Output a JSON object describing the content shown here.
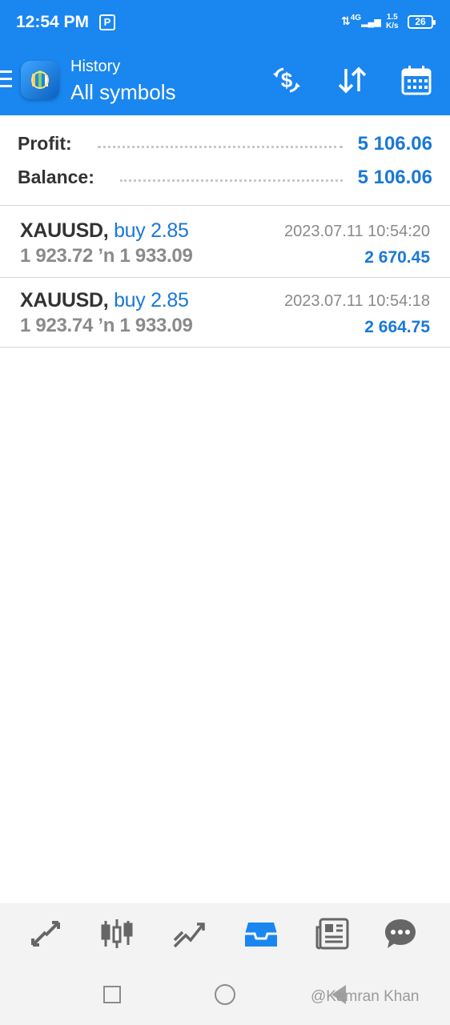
{
  "status": {
    "time": "12:54 PM",
    "notification_badge": "P",
    "network": "4G",
    "speed_top": "1.5",
    "speed_bottom": "K/s",
    "battery": "26"
  },
  "header": {
    "title_small": "History",
    "title_big": "All symbols",
    "icons": [
      "menu-icon",
      "app-logo-icon",
      "deposit-withdraw-icon",
      "sort-icon",
      "calendar-icon"
    ]
  },
  "summary": {
    "profit_label": "Profit:",
    "profit_value": "5 106.06",
    "balance_label": "Balance:",
    "balance_value": "5 106.06"
  },
  "trades": [
    {
      "symbol": "XAUUSD,",
      "side": "buy 2.85",
      "prices": "1 923.72 ’n  1 933.09",
      "time": "2023.07.11 10:54:20",
      "profit": "2 670.45"
    },
    {
      "symbol": "XAUUSD,",
      "side": "buy 2.85",
      "prices": "1 923.74 ’n  1 933.09",
      "time": "2023.07.11 10:54:18",
      "profit": "2 664.75"
    }
  ],
  "bottom_tabs": [
    "quotes-icon",
    "chart-icon",
    "trade-icon",
    "history-icon",
    "news-icon",
    "chat-icon"
  ],
  "active_tab": "history-icon",
  "watermark": "@Kamran Khan",
  "colors": {
    "accent": "#1a86f0",
    "value_blue": "#1a78d6",
    "text_dark": "#333333",
    "text_gray": "#8a8a8a"
  }
}
